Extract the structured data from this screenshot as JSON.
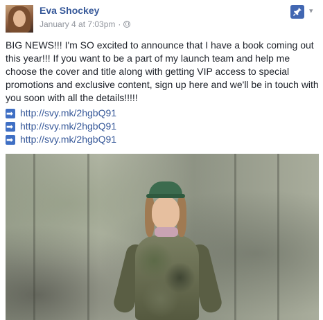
{
  "post": {
    "author": "Eva Shockey",
    "timestamp": "January 4 at 7:03pm",
    "separator": "·",
    "privacy_icon": "globe-icon",
    "pin_icon": "pin-icon",
    "menu_icon": "chevron-down-icon",
    "body": "BIG NEWS!!! I'm SO excited to announce that I have a book coming out this year!!! If you want to be a part of my launch team and help me choose the cover and title along with getting VIP access to special promotions and exclusive content, sign up here and we'll be in touch with you soon with all the details!!!!!",
    "links": [
      {
        "icon": "right-arrow-icon",
        "url": "http://svy.mk/2hgbQ91"
      },
      {
        "icon": "right-arrow-icon",
        "url": "http://svy.mk/2hgbQ91"
      },
      {
        "icon": "right-arrow-icon",
        "url": "http://svy.mk/2hgbQ91"
      }
    ]
  },
  "colors": {
    "author_link": "#365899",
    "meta_text": "#90949c",
    "pin_badge": "#4267b2",
    "arrow_badge": "#3f6fc4"
  }
}
